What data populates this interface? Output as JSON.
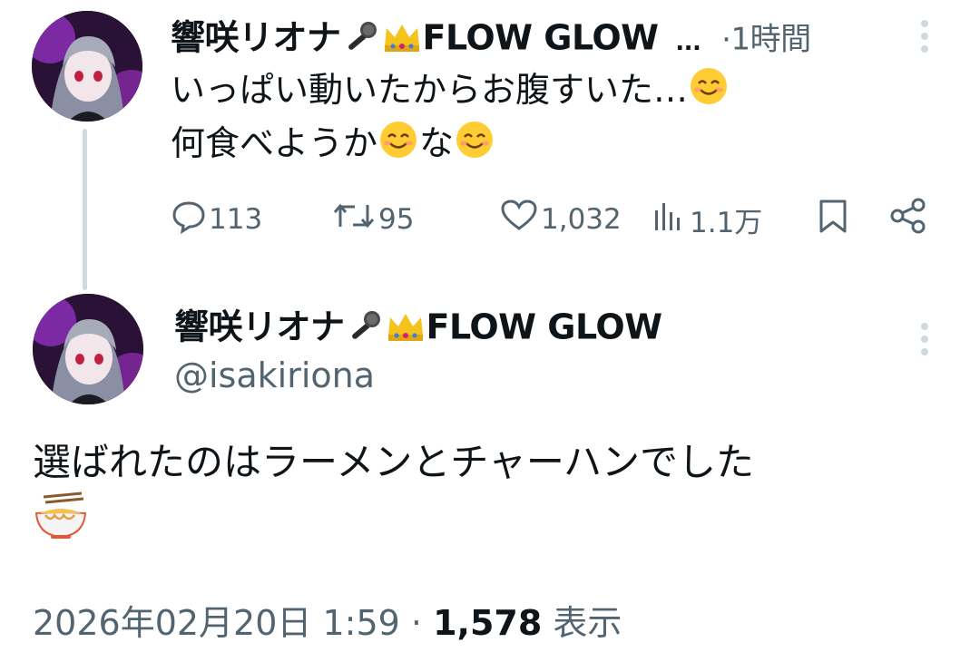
{
  "reply_tweet": {
    "display_name": "響咲リオナ",
    "display_name_suffix": "FLOW GLOW",
    "truncation": "...",
    "separator": "·",
    "timestamp": "1時間",
    "text_line1": "いっぱい動いたからお腹すいた…",
    "text_line2a": "何食べようか",
    "text_line2b": "な",
    "actions": {
      "replies": "113",
      "retweets": "95",
      "likes": "1,032",
      "views": "1.1万"
    }
  },
  "main_tweet": {
    "display_name": "響咲リオナ",
    "display_name_suffix": "FLOW GLOW",
    "handle": "@isakiriona",
    "text": "選ばれたのはラーメンとチャーハンでした",
    "date": "2026年02月20日 1:59",
    "separator": "·",
    "view_count": "1,578",
    "view_label": "表示"
  },
  "colors": {
    "text": "#0f1419",
    "muted": "#536471",
    "thread_line": "#cfd9de",
    "avatar_bg": "#2a1236",
    "accent_purple": "#c03cff"
  },
  "icons": [
    "microphone-icon",
    "crown-icon",
    "smiling-face-icon",
    "ramen-bowl-icon",
    "reply-icon",
    "retweet-icon",
    "like-icon",
    "views-icon",
    "bookmark-icon",
    "share-icon",
    "more-options-icon"
  ]
}
